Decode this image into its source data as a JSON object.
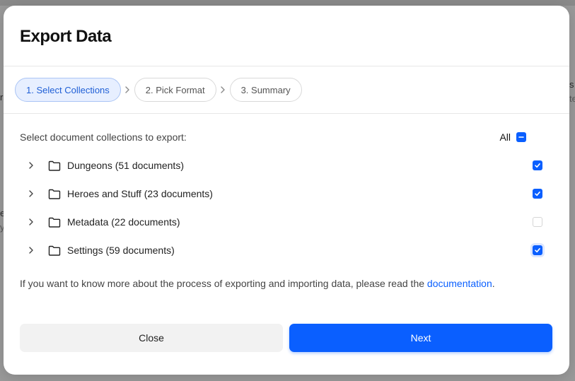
{
  "dialog": {
    "title": "Export Data"
  },
  "steps": [
    {
      "label": "1. Select Collections",
      "active": true
    },
    {
      "label": "2. Pick Format",
      "active": false
    },
    {
      "label": "3. Summary",
      "active": false
    }
  ],
  "selection": {
    "intro": "Select document collections to export:",
    "all_label": "All",
    "all_state": "indeterminate"
  },
  "collections": [
    {
      "label": "Dungeons (51 documents)",
      "checked": true
    },
    {
      "label": "Heroes and Stuff (23 documents)",
      "checked": true
    },
    {
      "label": "Metadata (22 documents)",
      "checked": false
    },
    {
      "label": "Settings (59 documents)",
      "checked": true
    }
  ],
  "info": {
    "text": "If you want to know more about the process of exporting and importing data, please read the ",
    "link": "documentation",
    "suffix": "."
  },
  "buttons": {
    "close": "Close",
    "next": "Next"
  },
  "colors": {
    "accent": "#0a5fff",
    "active_step_bg": "#e7efff"
  },
  "icons": [
    "chevron-right-icon",
    "folder-icon",
    "check-icon",
    "minus-icon"
  ]
}
